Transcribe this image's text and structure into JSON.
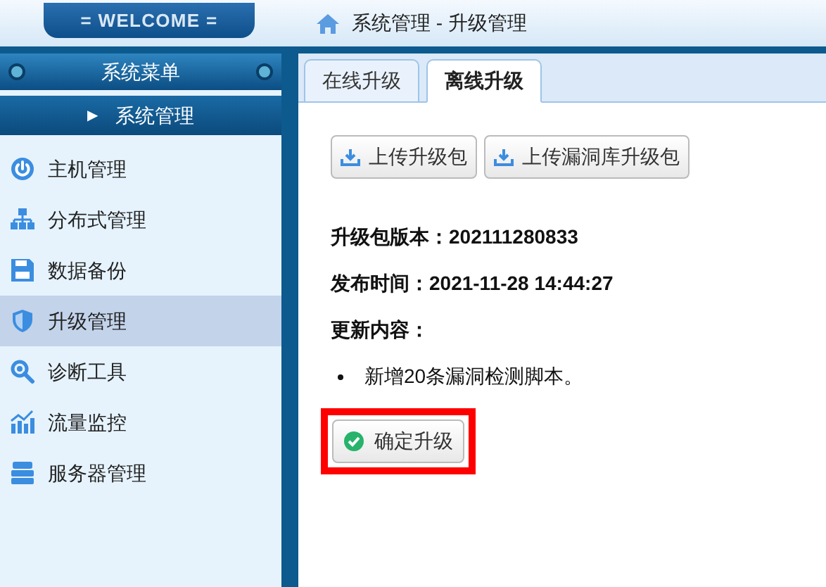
{
  "header": {
    "welcome": "= WELCOME =",
    "breadcrumb": "系统管理 - 升级管理"
  },
  "sidebar": {
    "title": "系统菜单",
    "section": {
      "marker": "▶",
      "label": "系统管理"
    },
    "items": [
      {
        "label": "主机管理",
        "selected": false
      },
      {
        "label": "分布式管理",
        "selected": false
      },
      {
        "label": "数据备份",
        "selected": false
      },
      {
        "label": "升级管理",
        "selected": true
      },
      {
        "label": "诊断工具",
        "selected": false
      },
      {
        "label": "流量监控",
        "selected": false
      },
      {
        "label": "服务器管理",
        "selected": false
      }
    ]
  },
  "tabs": [
    {
      "label": "在线升级",
      "selected": false
    },
    {
      "label": "离线升级",
      "selected": true
    }
  ],
  "upload_buttons": [
    {
      "label": "上传升级包"
    },
    {
      "label": "上传漏洞库升级包"
    }
  ],
  "info": [
    {
      "label": "升级包版本：",
      "value": "202111280833"
    },
    {
      "label": "发布时间：",
      "value": "2021-11-28 14:44:27"
    }
  ],
  "changes_label": "更新内容：",
  "changes": [
    "新增20条漏洞检测脚本。"
  ],
  "confirm_button": {
    "label": "确定升级",
    "highlighted": true
  }
}
